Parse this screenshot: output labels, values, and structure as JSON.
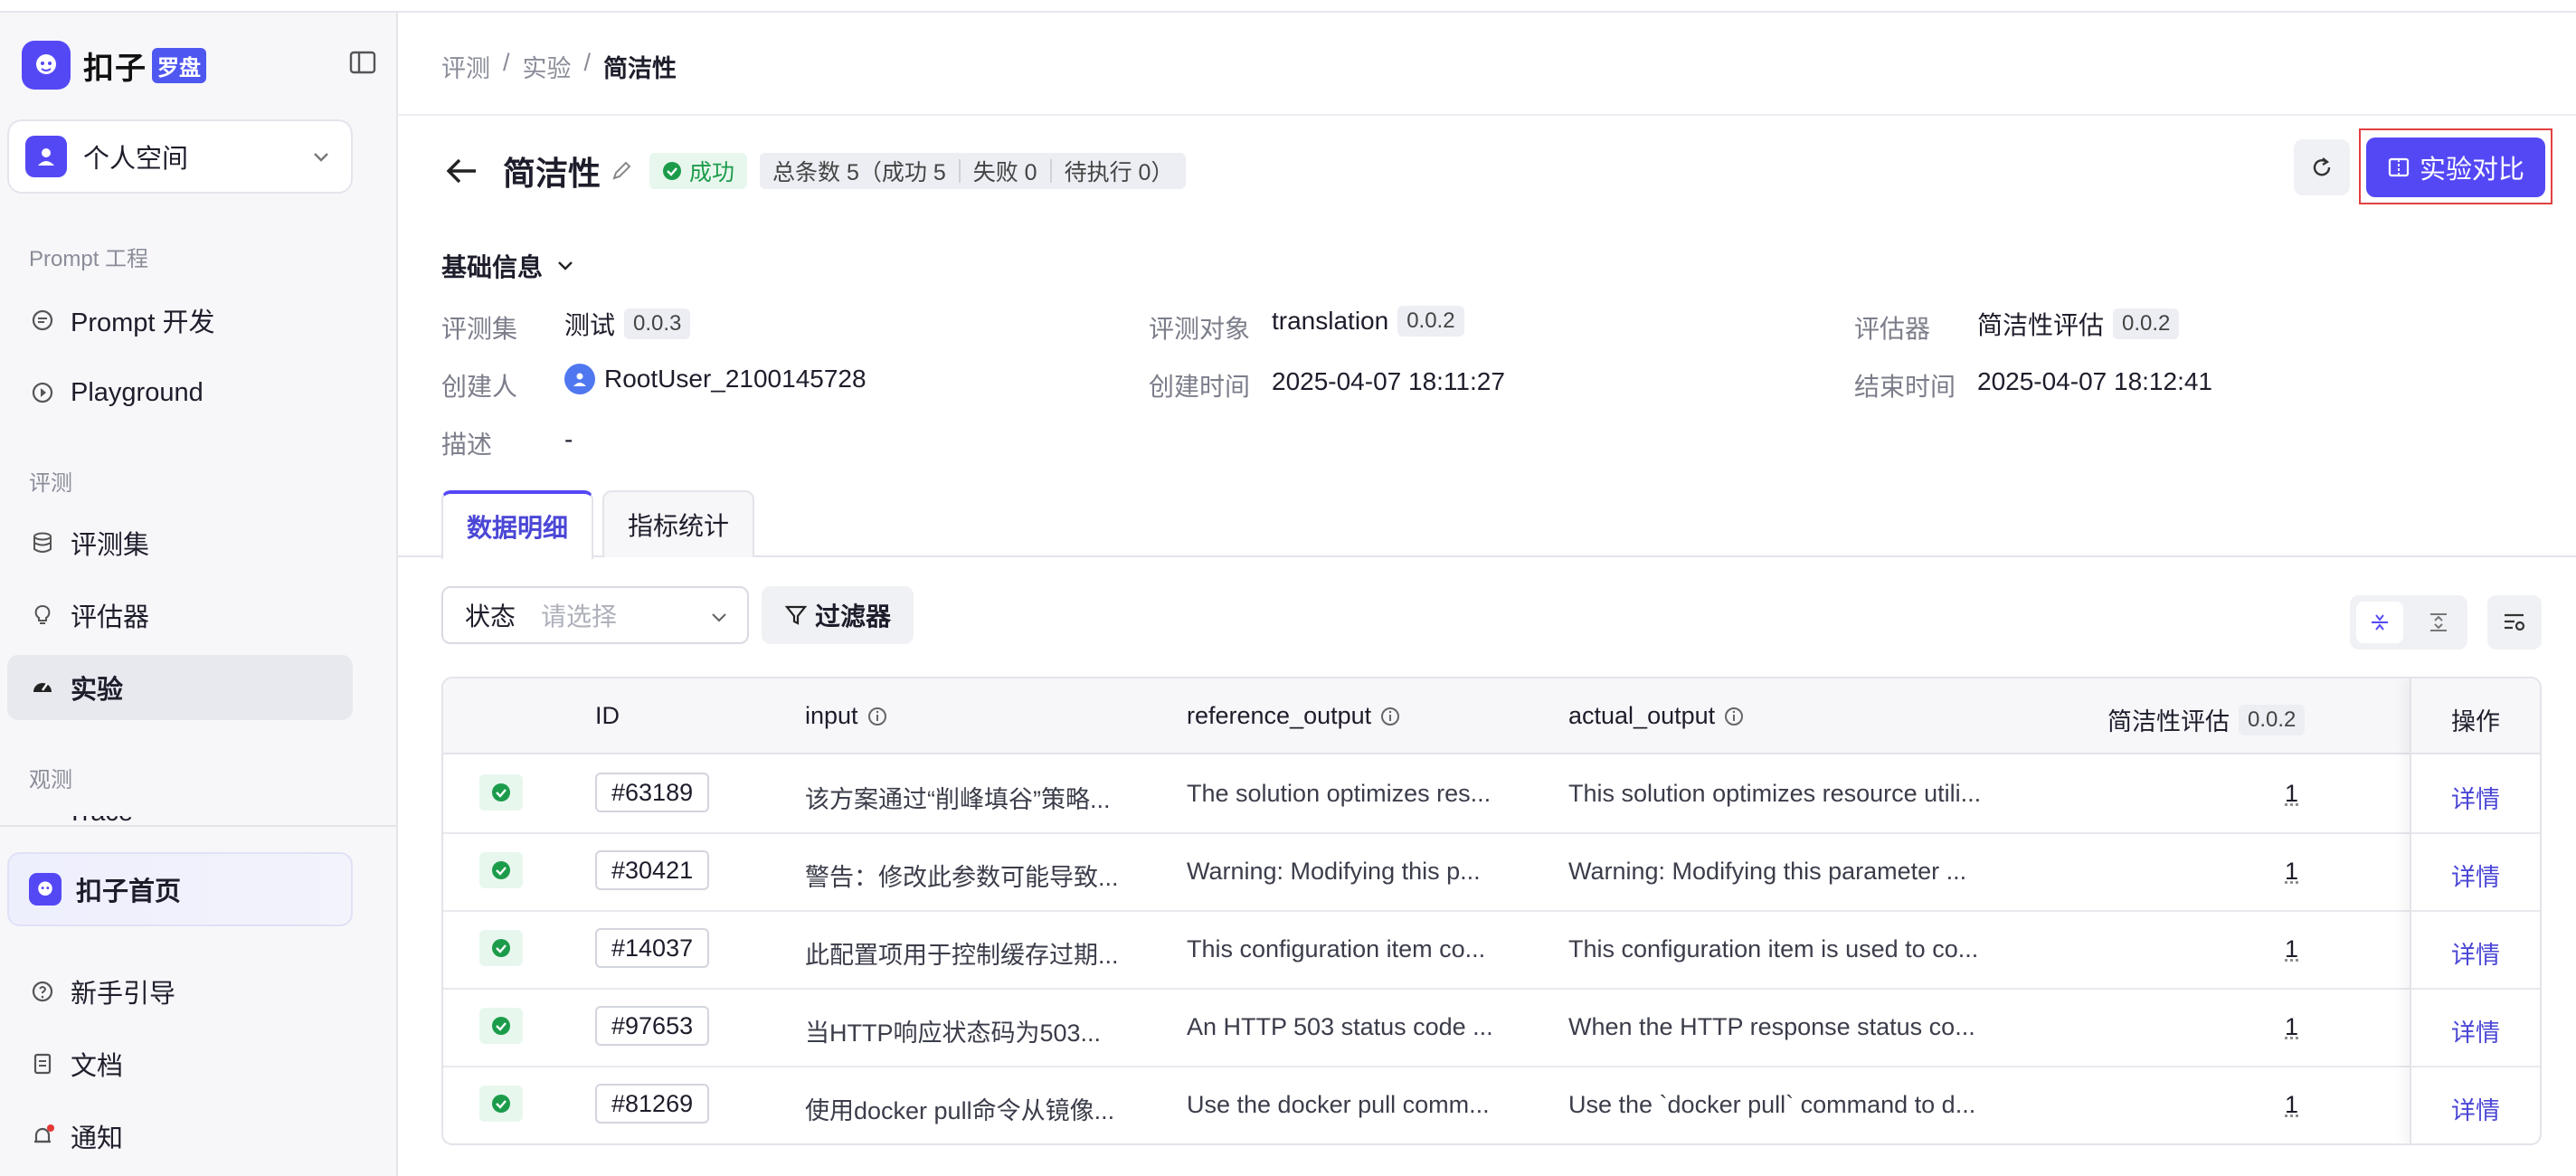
{
  "brand": {
    "name": "扣子",
    "badge": "罗盘"
  },
  "space": {
    "label": "个人空间"
  },
  "sidebar": {
    "sections": [
      {
        "title": "Prompt 工程",
        "items": [
          {
            "label": "Prompt 开发"
          },
          {
            "label": "Playground"
          }
        ]
      },
      {
        "title": "评测",
        "items": [
          {
            "label": "评测集"
          },
          {
            "label": "评估器"
          },
          {
            "label": "实验"
          }
        ]
      },
      {
        "title": "观测",
        "items": [
          {
            "label": "Trace"
          }
        ]
      }
    ],
    "home": "扣子首页",
    "bottom": [
      {
        "label": "新手引导"
      },
      {
        "label": "文档"
      },
      {
        "label": "通知"
      }
    ]
  },
  "breadcrumb": [
    "评测",
    "实验",
    "简洁性"
  ],
  "page": {
    "title": "简洁性",
    "status": "成功",
    "stats": {
      "total": "总条数 5（成功 5",
      "fail": "失败 0",
      "pending": "待执行 0）"
    },
    "compare_button": "实验对比"
  },
  "basic_info": {
    "toggle": "基础信息",
    "fields": {
      "dataset_label": "评测集",
      "dataset_value": "测试",
      "dataset_ver": "0.0.3",
      "target_label": "评测对象",
      "target_value": "translation",
      "target_ver": "0.0.2",
      "evaluator_label": "评估器",
      "evaluator_value": "简洁性评估",
      "evaluator_ver": "0.0.2",
      "creator_label": "创建人",
      "creator_value": "RootUser_2100145728",
      "created_label": "创建时间",
      "created_value": "2025-04-07 18:11:27",
      "ended_label": "结束时间",
      "ended_value": "2025-04-07 18:12:41",
      "desc_label": "描述",
      "desc_value": "-"
    }
  },
  "tabs": [
    "数据明细",
    "指标统计"
  ],
  "filter": {
    "label": "状态",
    "placeholder": "请选择",
    "filter_button": "过滤器"
  },
  "table": {
    "headers": {
      "id": "ID",
      "input": "input",
      "reference": "reference_output",
      "actual": "actual_output",
      "evaluator": "简洁性评估",
      "evaluator_ver": "0.0.2",
      "ops": "操作"
    },
    "rows": [
      {
        "id": "#63189",
        "input": "该方案通过“削峰填谷”策略...",
        "reference": "The solution optimizes res...",
        "actual": "This solution optimizes resource utili...",
        "score": "1",
        "op": "详情"
      },
      {
        "id": "#30421",
        "input": "警告：修改此参数可能导致...",
        "reference": "Warning: Modifying this p...",
        "actual": "Warning: Modifying this parameter ...",
        "score": "1",
        "op": "详情"
      },
      {
        "id": "#14037",
        "input": "此配置项用于控制缓存过期...",
        "reference": "This configuration item co...",
        "actual": "This configuration item is used to co...",
        "score": "1",
        "op": "详情"
      },
      {
        "id": "#97653",
        "input": "当HTTP响应状态码为503...",
        "reference": "An HTTP 503 status code ...",
        "actual": "When the HTTP response status co...",
        "score": "1",
        "op": "详情"
      },
      {
        "id": "#81269",
        "input": "使用docker pull命令从镜像...",
        "reference": "Use the docker pull comm...",
        "actual": "Use the `docker pull` command to d...",
        "score": "1",
        "op": "详情"
      }
    ]
  },
  "colors": {
    "accent": "#5448f5",
    "success": "#1c9c4b",
    "link": "#4b47d6",
    "highlight_outline": "#e34040"
  }
}
